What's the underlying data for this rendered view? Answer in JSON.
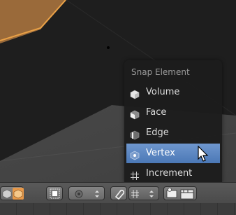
{
  "snap_menu": {
    "title": "Snap Element",
    "items": [
      {
        "label": "Volume",
        "icon": "volume-icon",
        "active": false
      },
      {
        "label": "Face",
        "icon": "face-icon",
        "active": false
      },
      {
        "label": "Edge",
        "icon": "edge-icon",
        "active": false
      },
      {
        "label": "Vertex",
        "icon": "vertex-icon",
        "active": true
      },
      {
        "label": "Increment",
        "icon": "increment-icon",
        "active": false
      }
    ]
  },
  "colors": {
    "menu_bg": "#1c1c1c",
    "highlight": "#5a86c5",
    "mesh_face": "#1e1e1e",
    "selected_edge": "#e8a046",
    "toolbar": "#555555"
  }
}
